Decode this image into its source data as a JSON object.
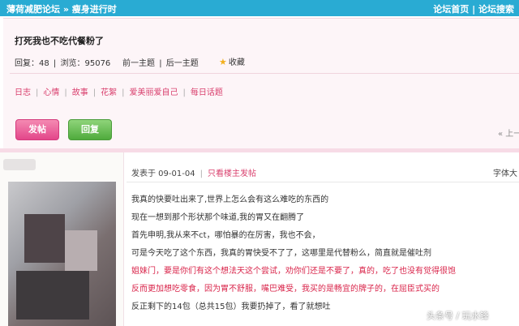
{
  "header": {
    "breadcrumb_home": "薄荷减肥论坛",
    "breadcrumb_sep": "»",
    "breadcrumb_section": "瘦身进行时",
    "link_home": "论坛首页",
    "link_sep": "|",
    "link_search": "论坛搜索"
  },
  "thread": {
    "title": "打死我也不吃代餐粉了",
    "reply_label": "回复：48",
    "view_label": "浏览：95076",
    "prev": "前一主题",
    "sep": "|",
    "next": "后一主题",
    "favorite": "收藏"
  },
  "categories": [
    "日志",
    "心情",
    "故事",
    "花絮",
    "爱美丽爱自己",
    "每日话题"
  ],
  "buttons": {
    "post": "发帖",
    "reply": "回复"
  },
  "pager": "« 上一",
  "post": {
    "date": "发表于 09-01-04",
    "only_author": "只看楼主发帖",
    "font_size": "字体大",
    "lines": [
      "我真的快要吐出来了,世界上怎么会有这么难吃的东西的",
      "现在一想到那个形状那个味道,我的胃又在翻腾了",
      "首先申明,我从来不ct，哪怕暴的在厉害，我也不会，",
      "可是今天吃了这个东西，我真的胃快受不了了，这哪里是代替粉么，简直就是催吐剂"
    ],
    "red_lines": [
      "姐妹门，要是你们有这个想法天这个尝试，劝你们还是不要了，真的，吃了也没有觉得很饱",
      "反而更加想吃零食，因为胃不舒服，嘴巴难受，我买的是畅宜的牌子的，在屈臣式买的"
    ],
    "last_line": "反正剩下的14包（总共15包）我要扔掉了，看了就想吐"
  },
  "watermark": "头条号 / 玩水锋",
  "colors": {
    "topbar": "#29abd3",
    "accent_pink": "#d9406e",
    "post_button": "#e3468a",
    "reply_button": "#4fab3c"
  }
}
